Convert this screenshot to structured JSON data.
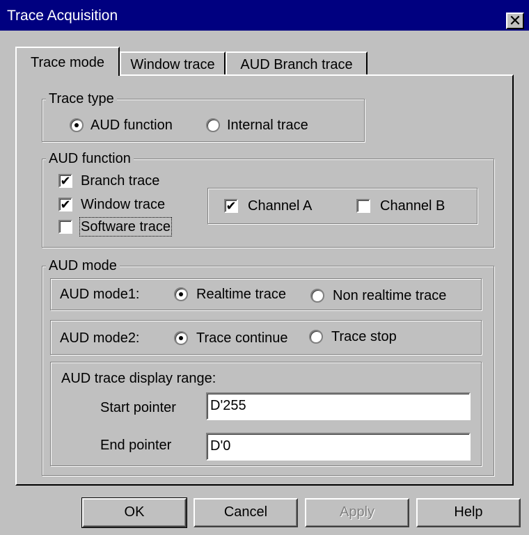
{
  "window": {
    "title": "Trace Acquisition",
    "close_glyph": "✕"
  },
  "tabs": [
    {
      "label": "Trace mode",
      "active": true
    },
    {
      "label": "Window trace",
      "active": false
    },
    {
      "label": "AUD Branch trace",
      "active": false
    }
  ],
  "trace_type": {
    "legend": "Trace type",
    "options": [
      {
        "label": "AUD function",
        "selected": true
      },
      {
        "label": "Internal trace",
        "selected": false
      }
    ]
  },
  "aud_function": {
    "legend": "AUD function",
    "checks": [
      {
        "label": "Branch trace",
        "checked": true
      },
      {
        "label": "Window trace",
        "checked": true
      },
      {
        "label": "Software trace",
        "checked": false
      }
    ],
    "channels": [
      {
        "label": "Channel A",
        "checked": true
      },
      {
        "label": "Channel B",
        "checked": false
      }
    ]
  },
  "aud_mode": {
    "legend": "AUD mode",
    "mode1": {
      "label": "AUD mode1:",
      "options": [
        {
          "label": "Realtime trace",
          "selected": true
        },
        {
          "label": "Non realtime trace",
          "selected": false
        }
      ]
    },
    "mode2": {
      "label": "AUD mode2:",
      "options": [
        {
          "label": "Trace continue",
          "selected": true
        },
        {
          "label": "Trace stop",
          "selected": false
        }
      ]
    },
    "range": {
      "label": "AUD trace display range:",
      "start_label": "Start pointer",
      "start_value": "D'255",
      "end_label": "End pointer",
      "end_value": "D'0"
    }
  },
  "buttons": {
    "ok": "OK",
    "cancel": "Cancel",
    "apply": "Apply",
    "help": "Help"
  },
  "icons": {
    "check_mark": "✔"
  }
}
